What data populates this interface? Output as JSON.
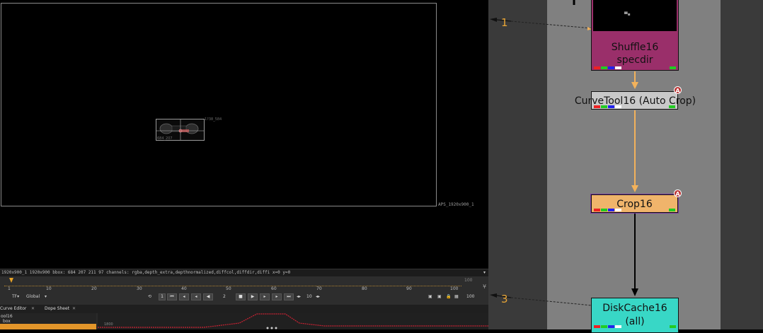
{
  "viewer": {
    "format_label": "APS_1920x900_1",
    "bbox_top_right": "1?38_584",
    "bbox_bottom_left": "684_207",
    "info_text": "1920x900_1 1920x900  bbox: 684 207 211 97 channels: rgba,depth_extra,depthnormalized,diffcol,diffdir,diffi x=0 y=0",
    "info_arrow": "▾"
  },
  "timeline": {
    "ticks": [
      "1",
      "10",
      "20",
      "30",
      "40",
      "50",
      "60",
      "70",
      "80",
      "90",
      "100"
    ],
    "end_frame": "100",
    "end_frame_box": "100",
    "tf_label": "TF▾",
    "global_label": "Global",
    "step_value": "10",
    "frame_field": "2",
    "fps_field": "1",
    "down_arrow": "¥"
  },
  "curve_editor": {
    "tab_curve": "Curve Editor",
    "tab_dope": "Dope Sheet",
    "tree_item_1": "ool16",
    "tree_item_2": "box",
    "graph_label": "1800"
  },
  "nodes": {
    "shuffle": {
      "label_line1": "Shuffle16",
      "label_line2": "specdir"
    },
    "curvetool": {
      "label": "CurveTool16 (Auto Crop)",
      "badge": "A"
    },
    "crop": {
      "label": "Crop16",
      "badge": "A"
    },
    "diskcache": {
      "label_line1": "DiskCache16",
      "label_line2": "(all)"
    }
  },
  "annotations": {
    "one": "1",
    "three": "3"
  },
  "colors": {
    "shuffle": "#9a2f6a",
    "curvetool": "#c9c9c9",
    "crop": "#f0b46b",
    "diskcache": "#38d7c6",
    "arrow_orange": "#f3b25b",
    "annotation": "#e9a636"
  }
}
